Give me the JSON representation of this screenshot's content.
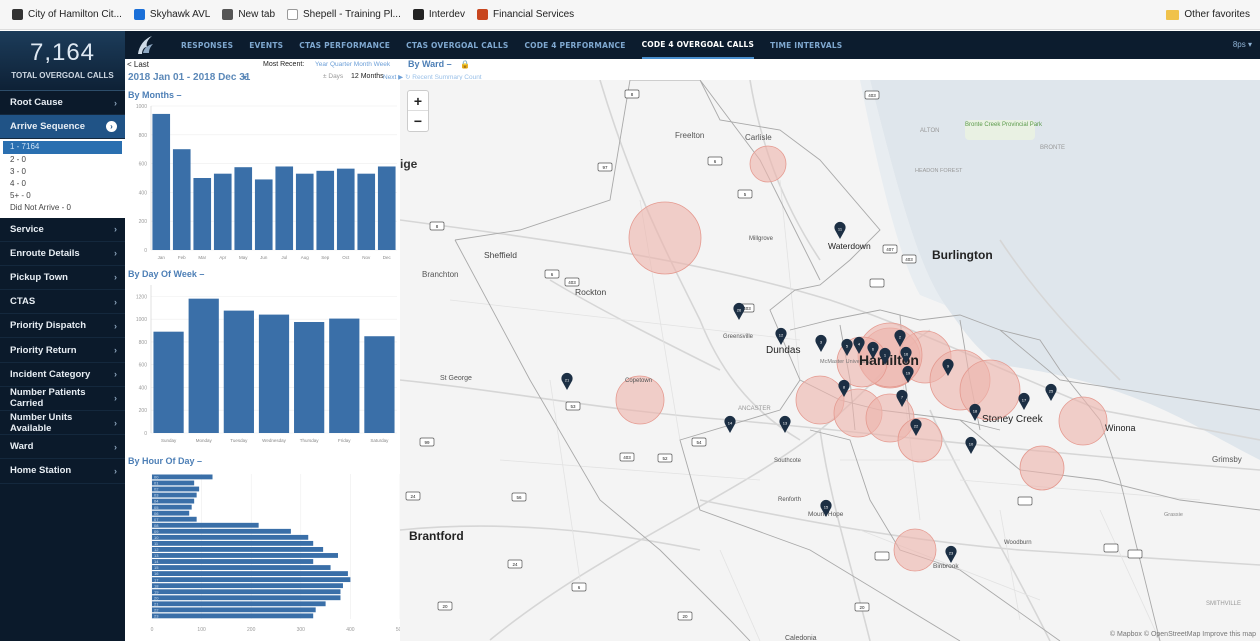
{
  "browser": {
    "favorites": [
      {
        "label": "City of Hamilton Cit...",
        "icon": "city-icon",
        "color": "#333333"
      },
      {
        "label": "Skyhawk AVL",
        "icon": "skyhawk-icon",
        "color": "#1a6fd8"
      },
      {
        "label": "New tab",
        "icon": "newtab-icon",
        "color": "#555555"
      },
      {
        "label": "Shepell - Training Pl...",
        "icon": "shepell-icon",
        "color": "#ffffff"
      },
      {
        "label": "Interdev",
        "icon": "interdev-icon",
        "color": "#222222"
      },
      {
        "label": "Financial Services",
        "icon": "financial-icon",
        "color": "#c8461f"
      }
    ],
    "other_favorites": "Other favorites"
  },
  "kpi": {
    "value": "7,164",
    "label": "TOTAL OVERGOAL CALLS"
  },
  "nav": {
    "tabs": [
      "RESPONSES",
      "EVENTS",
      "CTAS PERFORMANCE",
      "CTAS OVERGOAL CALLS",
      "CODE 4 PERFORMANCE",
      "CODE 4 OVERGOAL CALLS",
      "TIME INTERVALS"
    ],
    "active_index": 5,
    "right_label": "8ps ▾"
  },
  "sidebar": {
    "items": [
      "Root Cause",
      "Arrive Sequence",
      "Service",
      "Enroute Details",
      "Pickup Town",
      "CTAS",
      "Priority Dispatch",
      "Priority Return",
      "Incident Category",
      "Number Patients Carried",
      "Number Units Available",
      "Ward",
      "Home Station"
    ],
    "active_item": "Arrive Sequence",
    "sub_items": [
      "1 - 7164",
      "2 - 0",
      "3 - 0",
      "4 - 0",
      "5+ - 0",
      "Did Not Arrive - 0"
    ]
  },
  "filters": {
    "back": "< Last",
    "date_range": "2018 Jan 01 - 2018 Dec 31",
    "most_recent": "Most Recent:",
    "recent_options": "Year  Quarter  Month  Week",
    "group_by": "By Ward –",
    "days": "± Days",
    "months": "12 Months",
    "next": "Next ▶",
    "recent_link": "↻ Recent Summary Count"
  },
  "colors": {
    "bar": "#3a6fa8",
    "sidebar": "#0b1a2b",
    "accent": "#4d7fb6",
    "circle": "#eeb4ad",
    "pin": "#1c2f44"
  },
  "chart_data": [
    {
      "type": "bar",
      "title": "By Months –",
      "categories": [
        "Jan",
        "Feb",
        "Mar",
        "Apr",
        "May",
        "Jun",
        "Jul",
        "Aug",
        "Sep",
        "Oct",
        "Nov",
        "Dec"
      ],
      "values": [
        945,
        700,
        500,
        530,
        575,
        490,
        580,
        530,
        550,
        565,
        530,
        580
      ],
      "ylim": [
        0,
        1000
      ],
      "yticks": [
        0,
        200,
        400,
        600,
        800,
        1000
      ]
    },
    {
      "type": "bar",
      "title": "By Day Of Week –",
      "categories": [
        "Sunday",
        "Monday",
        "Tuesday",
        "Wednesday",
        "Thursday",
        "Friday",
        "Saturday"
      ],
      "values": [
        890,
        1180,
        1075,
        1040,
        975,
        1005,
        850
      ],
      "ylim": [
        0,
        1300
      ],
      "yticks": [
        0,
        200,
        400,
        600,
        800,
        1000,
        1200
      ]
    },
    {
      "type": "bar",
      "orientation": "horizontal",
      "title": "By Hour Of Day –",
      "categories": [
        "00",
        "01",
        "02",
        "03",
        "04",
        "05",
        "06",
        "07",
        "08",
        "09",
        "10",
        "11",
        "12",
        "13",
        "14",
        "15",
        "16",
        "17",
        "18",
        "19",
        "20",
        "21",
        "22",
        "23"
      ],
      "values": [
        122,
        85,
        95,
        90,
        85,
        80,
        75,
        90,
        215,
        280,
        315,
        325,
        345,
        375,
        325,
        360,
        395,
        400,
        385,
        380,
        380,
        350,
        330,
        325
      ],
      "xlim": [
        0,
        500
      ],
      "xticks": [
        0,
        100,
        200,
        300,
        400,
        500
      ]
    }
  ],
  "map": {
    "labels": [
      "Freelton",
      "Carlisle",
      "Millgrove",
      "Waterdown",
      "Burlington",
      "ALTON",
      "Bronte Creek Provincial Park",
      "BRONTE",
      "HEADON FOREST",
      "Sheffield",
      "Branchton",
      "Rockton",
      "Greensville",
      "Dundas",
      "McMaster University",
      "Hamilton",
      "St George",
      "Copetown",
      "ANCASTER",
      "Stoney Creek",
      "Winona",
      "Grimsby",
      "Southcote",
      "Renforth",
      "Mount Hope",
      "Binbrook",
      "Woodburn",
      "Brantford",
      "Caledonia",
      "Grassie",
      "SMITHVILLE"
    ],
    "highways": [
      "8",
      "6",
      "5",
      "97",
      "8",
      "6",
      "403",
      "403",
      "403",
      "407",
      "403",
      "24",
      "99",
      "53",
      "403",
      "52",
      "54",
      "56",
      "24",
      "6",
      "20",
      "20",
      "20"
    ],
    "pins": [
      "11",
      "26",
      "12",
      "3",
      "5",
      "4",
      "6",
      "1",
      "2",
      "16",
      "8",
      "7",
      "19",
      "9",
      "18",
      "17",
      "25",
      "21",
      "14",
      "13",
      "22",
      "15",
      "10",
      "23"
    ],
    "zoom_in": "+",
    "zoom_out": "−",
    "attribution": "© Mapbox © OpenStreetMap Improve this map"
  }
}
